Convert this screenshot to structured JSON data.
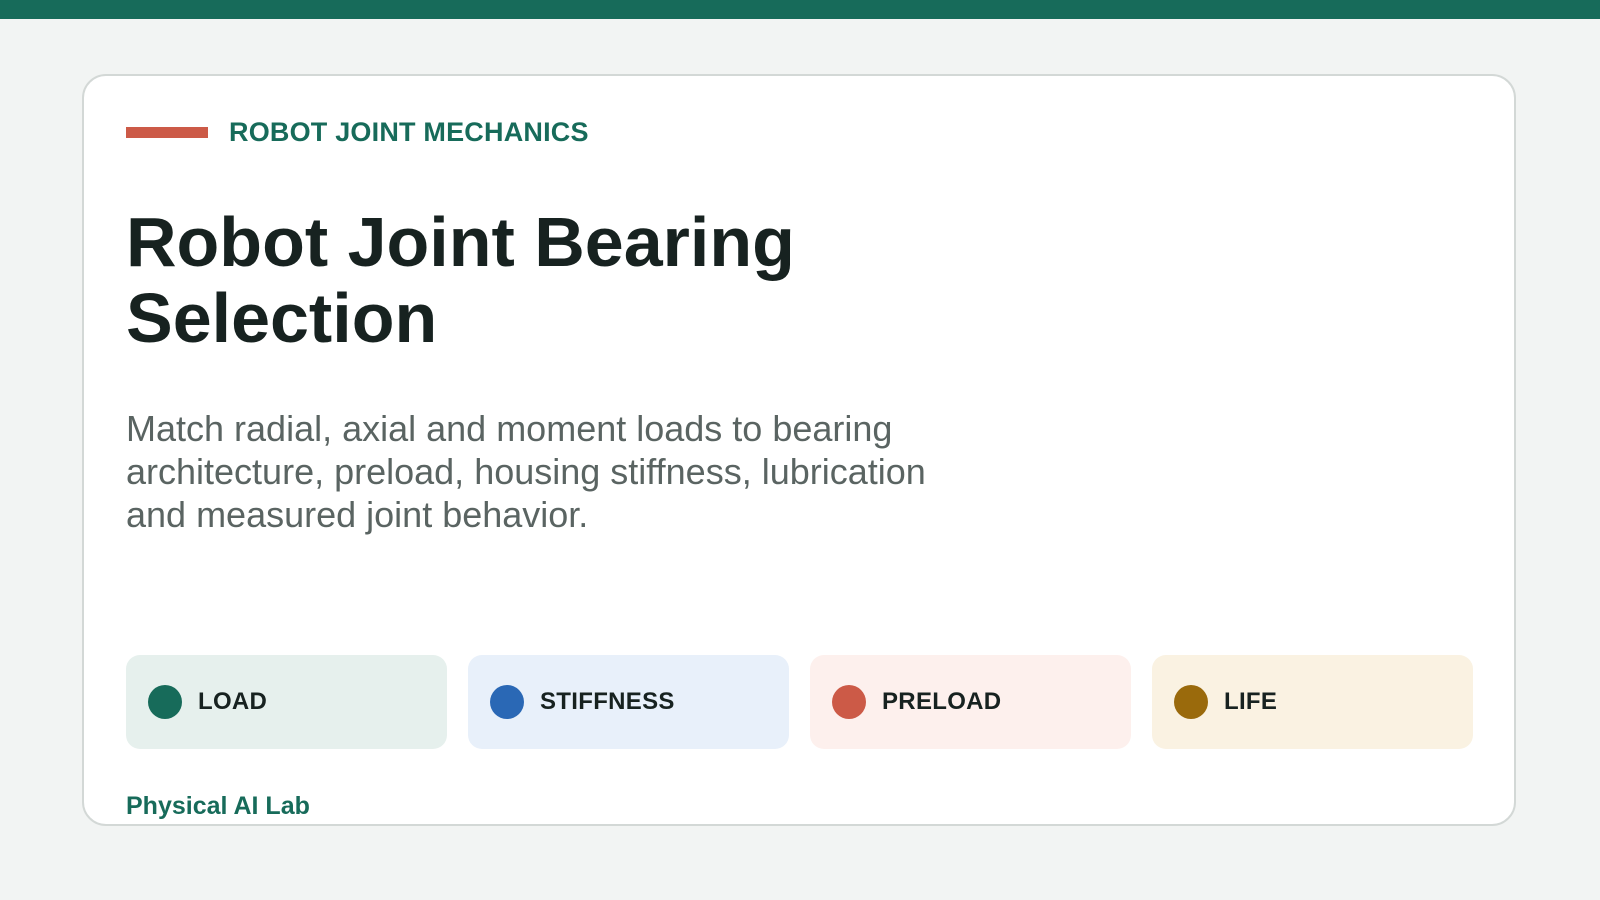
{
  "eyebrow": {
    "label": "ROBOT JOINT MECHANICS",
    "accent_color": "#cc5a47"
  },
  "title": "Robot Joint Bearing Selection",
  "subtitle": "Match radial, axial and moment loads to bearing architecture, preload, housing stiffness, lubrication and measured joint behavior.",
  "chips": [
    {
      "label": "LOAD",
      "dot_color": "#176b5a",
      "bg_color": "#e6f0ed"
    },
    {
      "label": "STIFFNESS",
      "dot_color": "#2a68b5",
      "bg_color": "#e8f0fa"
    },
    {
      "label": "PRELOAD",
      "dot_color": "#cc5a47",
      "bg_color": "#fdf0ed"
    },
    {
      "label": "LIFE",
      "dot_color": "#9a6a0c",
      "bg_color": "#faf2e2"
    }
  ],
  "footer": {
    "brand": "Physical AI Lab"
  },
  "theme": {
    "primary": "#176b5a",
    "text_dark": "#172220",
    "text_muted": "#5a6462",
    "page_bg": "#f2f4f3"
  }
}
